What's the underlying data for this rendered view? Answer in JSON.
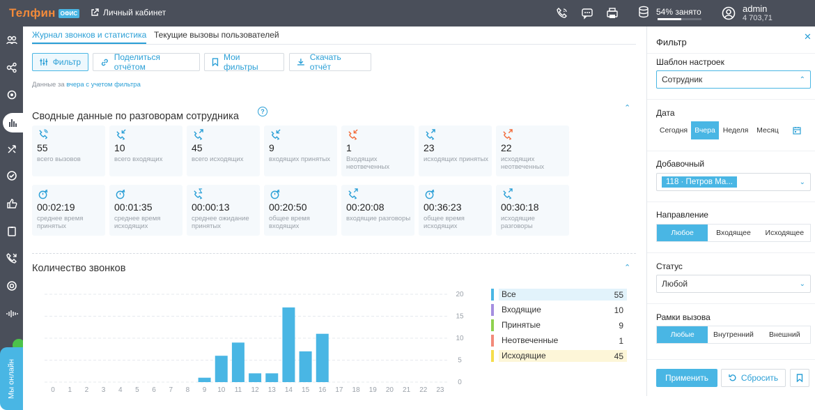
{
  "app": {
    "logo": "Телфин",
    "logo_badge": "офис",
    "cabinet_label": "Личный кабинет",
    "storage_text": "54% занято",
    "storage_used": 0.54,
    "user_name": "admin",
    "user_balance": "4 703,71",
    "online_label": "Мы онлайн"
  },
  "tabs": [
    {
      "label": "Журнал звонков и статистика",
      "active": true
    },
    {
      "label": "Текущие вызовы пользователей",
      "active": false
    }
  ],
  "toolbar": {
    "filter": "Фильтр",
    "share": "Поделиться отчётом",
    "my_filters": "Мои фильтры",
    "download": "Скачать отчёт"
  },
  "note": {
    "prefix": "Данные за",
    "link": "вчера с учетом фильтра"
  },
  "summary": {
    "title": "Сводные данные по разговорам сотрудника",
    "help": "?",
    "cards": [
      {
        "value": "55",
        "label": "всего вызовов",
        "icon": "phone-icon",
        "color": "#2a9fd6"
      },
      {
        "value": "10",
        "label": "всего входящих",
        "icon": "incoming-call-icon",
        "color": "#2a9fd6"
      },
      {
        "value": "45",
        "label": "всего исходящих",
        "icon": "outgoing-call-icon",
        "color": "#2a9fd6"
      },
      {
        "value": "9",
        "label": "входящих принятых",
        "icon": "incoming-call-icon",
        "color": "#2a9fd6"
      },
      {
        "value": "1",
        "label": "Входящих неотвеченных",
        "icon": "missed-incoming-icon",
        "color": "#f26b3a"
      },
      {
        "value": "23",
        "label": "исходящих принятых",
        "icon": "outgoing-call-icon",
        "color": "#2a9fd6"
      },
      {
        "value": "22",
        "label": "исходящих неотвеченных",
        "icon": "missed-outgoing-icon",
        "color": "#f26b3a"
      },
      {
        "value": "00:02:19",
        "label": "среднее время принятых",
        "icon": "timer-icon",
        "color": "#2a9fd6"
      },
      {
        "value": "00:01:35",
        "label": "среднее время исходящих",
        "icon": "timer-icon",
        "color": "#2a9fd6"
      },
      {
        "value": "00:00:13",
        "label": "среднее ожидание принятых",
        "icon": "wait-icon",
        "color": "#2a9fd6"
      },
      {
        "value": "00:20:50",
        "label": "общее время входящих",
        "icon": "timer-icon",
        "color": "#2a9fd6"
      },
      {
        "value": "00:20:08",
        "label": "входящие разговоры",
        "icon": "talk-icon",
        "color": "#2a9fd6"
      },
      {
        "value": "00:36:23",
        "label": "общее время исходящих",
        "icon": "timer-icon",
        "color": "#2a9fd6"
      },
      {
        "value": "00:30:18",
        "label": "исходящие разговоры",
        "icon": "talk-icon",
        "color": "#2a9fd6"
      }
    ]
  },
  "calls": {
    "title": "Количество звонков"
  },
  "chart_data": {
    "type": "bar",
    "categories": [
      "0",
      "1",
      "2",
      "3",
      "4",
      "5",
      "6",
      "7",
      "8",
      "9",
      "10",
      "11",
      "12",
      "13",
      "14",
      "15",
      "16",
      "17",
      "18",
      "19",
      "20",
      "21",
      "22",
      "23"
    ],
    "values": [
      0,
      0,
      0,
      0,
      0,
      0,
      0,
      0,
      0,
      1,
      6,
      9,
      2,
      2,
      17,
      7,
      11,
      0,
      0,
      0,
      0,
      0,
      0,
      0
    ],
    "ylim": [
      0,
      20
    ],
    "yticks": [
      "0",
      "5",
      "10",
      "15",
      "20"
    ],
    "bar_color": "#49b6e4",
    "grid": true,
    "legend": [
      {
        "name": "Все",
        "value": "55",
        "color": "#49b6e4",
        "bg": "#e2f3fb"
      },
      {
        "name": "Входящие",
        "value": "10",
        "color": "#a58ee0",
        "bg": "#ffffff"
      },
      {
        "name": "Принятые",
        "value": "9",
        "color": "#8fd14f",
        "bg": "#ffffff"
      },
      {
        "name": "Неотвеченные",
        "value": "1",
        "color": "#f28a7a",
        "bg": "#ffffff"
      },
      {
        "name": "Исходящие",
        "value": "45",
        "color": "#f5dd4b",
        "bg": "#fdf6d8"
      }
    ]
  },
  "filter": {
    "title": "Фильтр",
    "template_label": "Шаблон настроек",
    "template_value": "Сотрудник",
    "date_label": "Дата",
    "date_options": [
      {
        "label": "Сегодня",
        "on": false
      },
      {
        "label": "Вчера",
        "on": true
      },
      {
        "label": "Неделя",
        "on": false
      },
      {
        "label": "Месяц",
        "on": false
      }
    ],
    "ext_label": "Добавочный",
    "ext_value": "118 · Петров Ма...",
    "direction_label": "Направление",
    "direction_options": [
      {
        "label": "Любое",
        "on": true
      },
      {
        "label": "Входящее",
        "on": false
      },
      {
        "label": "Исходящее",
        "on": false
      }
    ],
    "status_label": "Статус",
    "status_value": "Любой",
    "frame_label": "Рамки вызова",
    "frame_options": [
      {
        "label": "Любые",
        "on": true
      },
      {
        "label": "Внутренний",
        "on": false
      },
      {
        "label": "Внешний",
        "on": false
      }
    ],
    "apply": "Применить",
    "reset": "Сбросить"
  }
}
